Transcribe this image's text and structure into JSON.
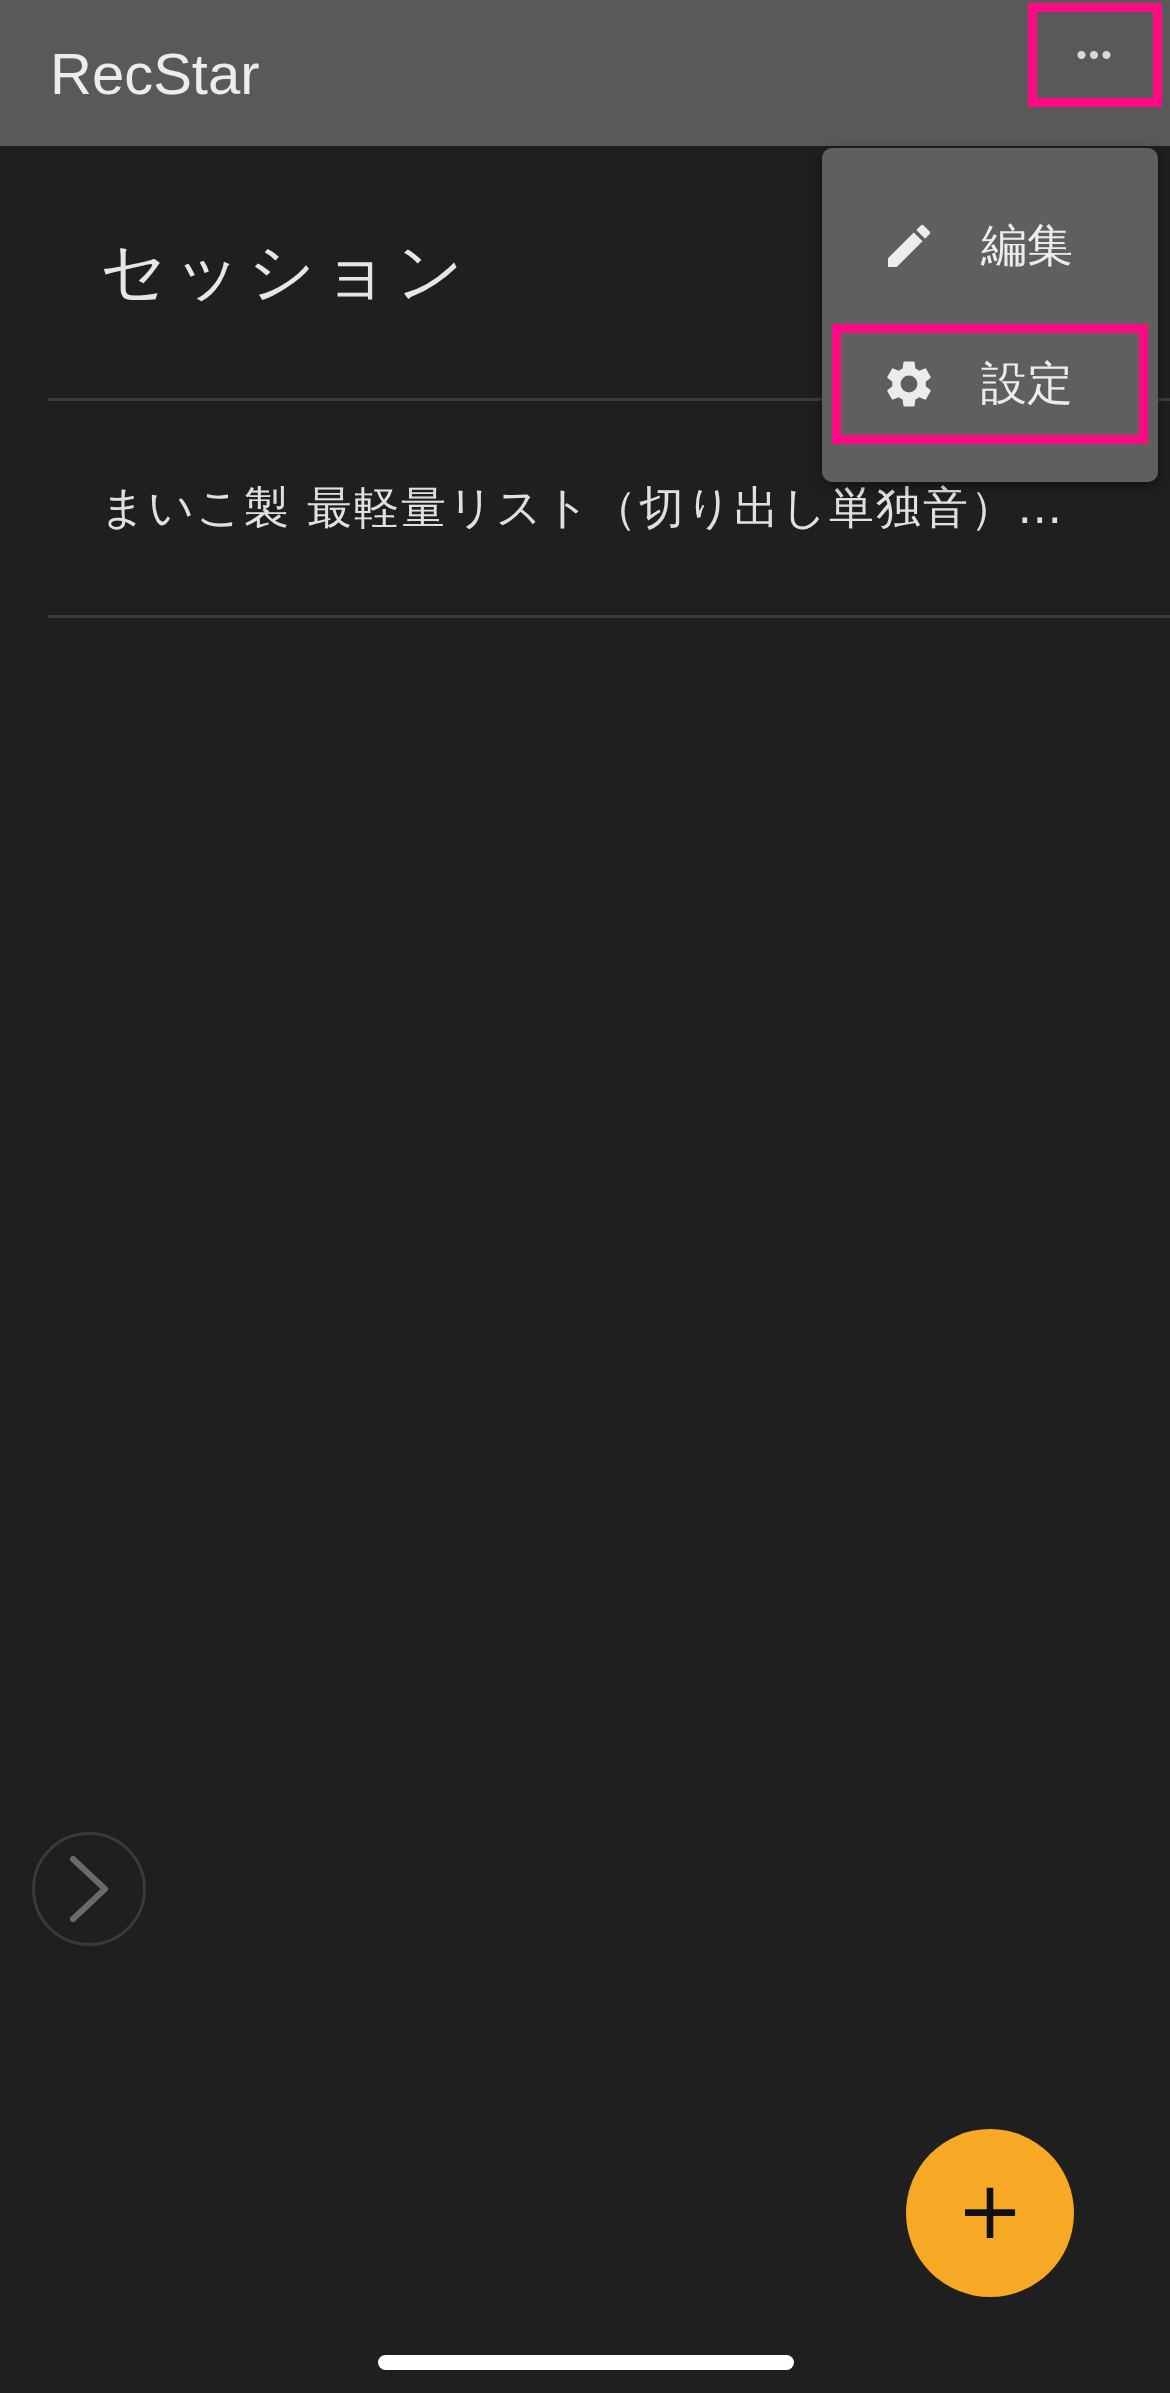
{
  "app_bar": {
    "title": "RecStar",
    "more_button": {
      "label": "•••",
      "highlighted": true
    }
  },
  "menu": {
    "items": [
      {
        "kind": "edit",
        "label": "編集",
        "highlighted": false
      },
      {
        "kind": "settings",
        "label": "設定",
        "highlighted": true
      }
    ]
  },
  "section": {
    "title": "セッション"
  },
  "sessions": [
    {
      "title": "まいこ製 最軽量リスト（切り出し単独音）…"
    }
  ],
  "fab": {
    "label": "+"
  }
}
